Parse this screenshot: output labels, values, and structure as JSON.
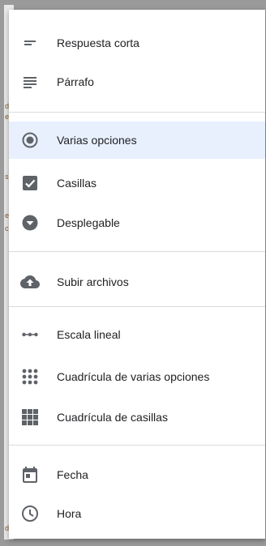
{
  "menu": {
    "items": [
      {
        "label": "Respuesta corta",
        "icon": "short-answer-icon"
      },
      {
        "label": "Párrafo",
        "icon": "paragraph-icon"
      },
      {
        "label": "Varias opciones",
        "icon": "radio-button-icon",
        "selected": true
      },
      {
        "label": "Casillas",
        "icon": "checkbox-icon"
      },
      {
        "label": "Desplegable",
        "icon": "dropdown-icon"
      },
      {
        "label": "Subir archivos",
        "icon": "cloud-upload-icon"
      },
      {
        "label": "Escala lineal",
        "icon": "linear-scale-icon"
      },
      {
        "label": "Cuadrícula de varias opciones",
        "icon": "dots-grid-icon"
      },
      {
        "label": "Cuadrícula de casillas",
        "icon": "checkbox-grid-icon"
      },
      {
        "label": "Fecha",
        "icon": "calendar-icon"
      },
      {
        "label": "Hora",
        "icon": "clock-icon"
      }
    ]
  },
  "colors": {
    "icon": "#5f6368",
    "selected_background": "#e8f0fe",
    "text": "#202124",
    "divider": "#dadce0"
  }
}
